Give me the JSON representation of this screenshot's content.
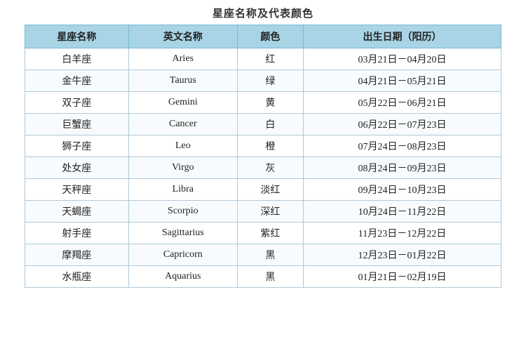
{
  "title": "星座名称及代表颜色",
  "headers": [
    "星座名称",
    "英文名称",
    "颜色",
    "出生日期（阳历）"
  ],
  "rows": [
    {
      "chinese": "白羊座",
      "english": "Aries",
      "color": "红",
      "dates": "03月21日－04月20日"
    },
    {
      "chinese": "金牛座",
      "english": "Taurus",
      "color": "绿",
      "dates": "04月21日－05月21日"
    },
    {
      "chinese": "双子座",
      "english": "Gemini",
      "color": "黄",
      "dates": "05月22日－06月21日"
    },
    {
      "chinese": "巨蟹座",
      "english": "Cancer",
      "color": "白",
      "dates": "06月22日－07月23日"
    },
    {
      "chinese": "狮子座",
      "english": "Leo",
      "color": "橙",
      "dates": "07月24日－08月23日"
    },
    {
      "chinese": "处女座",
      "english": "Virgo",
      "color": "灰",
      "dates": "08月24日－09月23日"
    },
    {
      "chinese": "天秤座",
      "english": "Libra",
      "color": "淡红",
      "dates": "09月24日－10月23日"
    },
    {
      "chinese": "天蝎座",
      "english": "Scorpio",
      "color": "深红",
      "dates": "10月24日－11月22日"
    },
    {
      "chinese": "射手座",
      "english": "Sagittarius",
      "color": "紫红",
      "dates": "11月23日－12月22日"
    },
    {
      "chinese": "摩羯座",
      "english": "Capricorn",
      "color": "黑",
      "dates": "12月23日－01月22日"
    },
    {
      "chinese": "水瓶座",
      "english": "Aquarius",
      "color": "黑",
      "dates": "01月21日－02月19日"
    }
  ]
}
